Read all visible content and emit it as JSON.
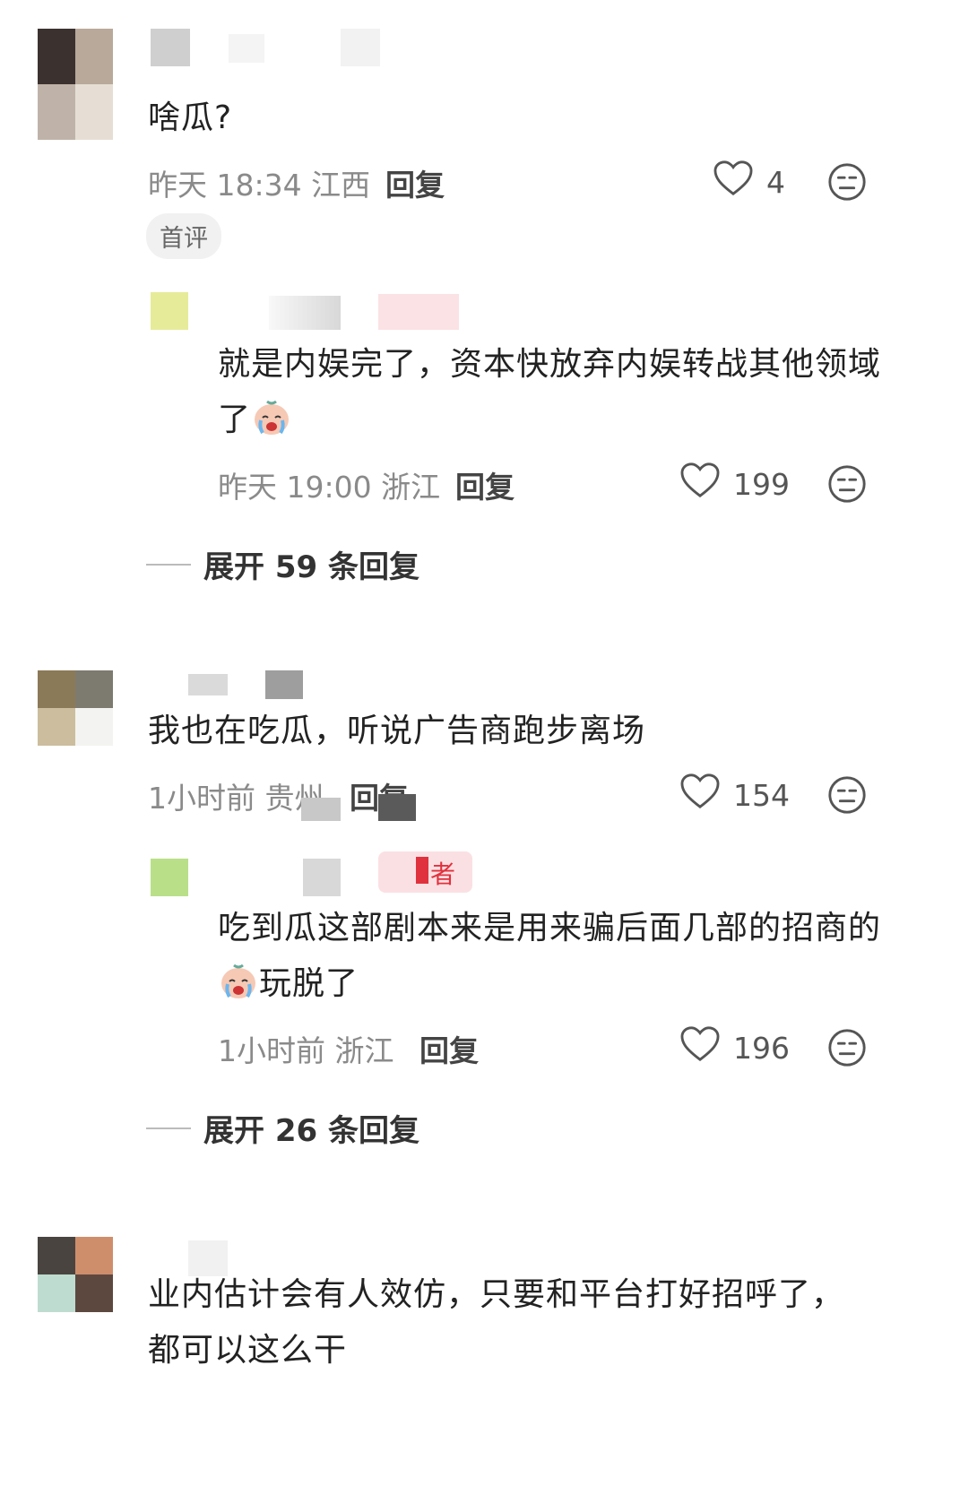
{
  "comments": [
    {
      "text": "啥瓜?",
      "time": "昨天 18:34",
      "location": "江西",
      "reply_label": "回复",
      "likes": "4",
      "badge": "首评"
    },
    {
      "text": "就是内娱完了，资本快放弃内娱转战其他领域了",
      "time": "昨天 19:00",
      "location": "浙江",
      "reply_label": "回复",
      "likes": "199",
      "emoji": "crying-face-emoji"
    },
    {
      "expand": "展开 59 条回复"
    },
    {
      "text": "我也在吃瓜，听说广告商跑步离场",
      "time": "1小时前",
      "location": "贵州",
      "reply_label": "回复",
      "likes": "154"
    },
    {
      "author_tag": "者",
      "text_before_emoji": "吃到瓜这部剧本来是用来骗后面几部的招商的",
      "text_after_emoji": "玩脱了",
      "time": "1小时前",
      "location": "浙江",
      "reply_label": "回复",
      "likes": "196",
      "emoji": "crying-face-emoji"
    },
    {
      "expand": "展开 26 条回复"
    },
    {
      "text": "业内估计会有人效仿，只要和平台打好招呼了，都可以这么干"
    }
  ],
  "icons": {
    "like": "heart-outline-icon",
    "reaction": "neutral-face-icon"
  },
  "colors": {
    "accent_tag": "#e0323e",
    "meta_text": "#8a8a8a"
  }
}
